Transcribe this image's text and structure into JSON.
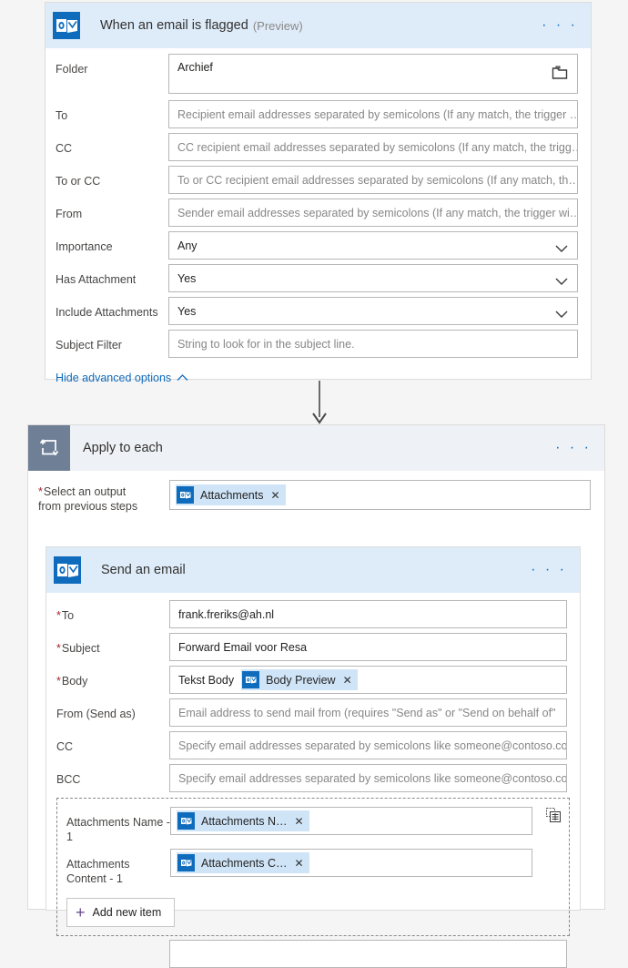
{
  "trigger_card": {
    "icon": "outlook-icon",
    "title": "When an email is flagged",
    "subtitle": "(Preview)",
    "menu": "· · ·",
    "fields": [
      {
        "label": "Folder",
        "required": false,
        "type": "text-with-picker",
        "value": "Archief",
        "placeholder": "",
        "icon": "folder-icon"
      },
      {
        "label": "To",
        "required": false,
        "type": "text",
        "value": "",
        "placeholder": "Recipient email addresses separated by semicolons (If any match, the trigger …"
      },
      {
        "label": "CC",
        "required": false,
        "type": "text",
        "value": "",
        "placeholder": "CC recipient email addresses separated by semicolons (If any match, the trigg…"
      },
      {
        "label": "To or CC",
        "required": false,
        "type": "text",
        "value": "",
        "placeholder": "To or CC recipient email addresses separated by semicolons (If any match, th…"
      },
      {
        "label": "From",
        "required": false,
        "type": "text",
        "value": "",
        "placeholder": "Sender email addresses separated by semicolons (If any match, the trigger wi…"
      },
      {
        "label": "Importance",
        "required": false,
        "type": "select",
        "value": "Any",
        "placeholder": "",
        "icon": "chevron-down-icon"
      },
      {
        "label": "Has Attachment",
        "required": false,
        "type": "select",
        "value": "Yes",
        "placeholder": "",
        "icon": "chevron-down-icon"
      },
      {
        "label": "Include Attachments",
        "required": false,
        "type": "select",
        "value": "Yes",
        "placeholder": "",
        "icon": "chevron-down-icon"
      },
      {
        "label": "Subject Filter",
        "required": false,
        "type": "text",
        "value": "",
        "placeholder": "String to look for in the subject line."
      }
    ],
    "advanced_link": "Hide advanced options"
  },
  "loop_card": {
    "icon": "loop-icon",
    "title": "Apply to each",
    "menu": "· · ·",
    "select_output": {
      "label_line1": "Select an output",
      "label_line2": "from previous steps",
      "required": true,
      "token": {
        "text": "Attachments",
        "icon": "outlook-icon",
        "remove": "✕"
      }
    }
  },
  "action_card": {
    "icon": "outlook-icon",
    "title": "Send an email",
    "menu": "· · ·",
    "fields": [
      {
        "label": "To",
        "required": true,
        "type": "text",
        "value": "frank.freriks@ah.nl",
        "placeholder": ""
      },
      {
        "label": "Subject",
        "required": true,
        "type": "text",
        "value": "Forward Email voor Resa",
        "placeholder": ""
      },
      {
        "label": "Body",
        "required": true,
        "type": "mixed",
        "plain_text": "Tekst Body",
        "token": {
          "text": "Body Preview",
          "icon": "outlook-icon",
          "remove": "✕"
        }
      },
      {
        "label": "From (Send as)",
        "required": false,
        "type": "text",
        "value": "",
        "placeholder": "Email address to send mail from (requires \"Send as\" or \"Send on behalf of\""
      },
      {
        "label": "CC",
        "required": false,
        "type": "text",
        "value": "",
        "placeholder": "Specify email addresses separated by semicolons like someone@contoso.com"
      },
      {
        "label": "BCC",
        "required": false,
        "type": "text",
        "value": "",
        "placeholder": "Specify email addresses separated by semicolons like someone@contoso.com"
      }
    ],
    "attachments_group": {
      "array_icon": "switch-to-array-icon",
      "rows": [
        {
          "label": "Attachments Name - 1",
          "token": {
            "text": "Attachments N…",
            "icon": "outlook-icon",
            "remove": "✕"
          }
        },
        {
          "label": "Attachments Content - 1",
          "token": {
            "text": "Attachments C…",
            "icon": "outlook-icon",
            "remove": "✕"
          }
        }
      ],
      "add_button": {
        "label": "Add new item",
        "icon": "plus-icon"
      }
    }
  },
  "colors": {
    "outlook_blue": "#0f6cbd",
    "header_blue": "#deecf9",
    "loop_gray": "#6e7f96",
    "loop_header": "#eef1f5",
    "token_blue": "#cfe4f7",
    "required_red": "#a4262c",
    "page_bg": "#f5f5f5"
  }
}
